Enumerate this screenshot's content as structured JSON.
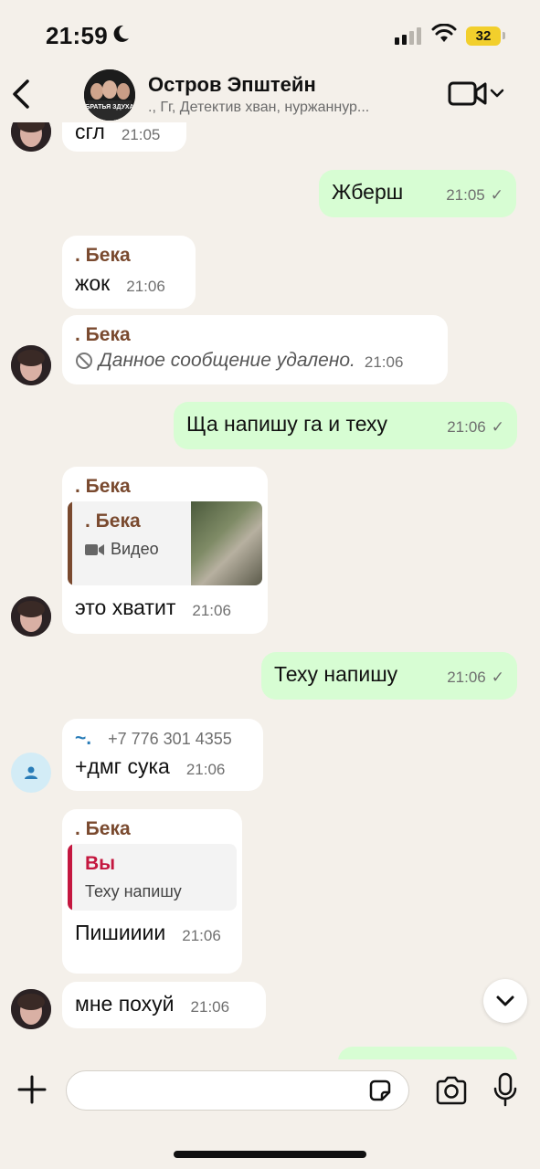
{
  "status_bar": {
    "time": "21:59",
    "battery": "32",
    "battery_color": "#f2cf2c"
  },
  "header": {
    "title": "Остров Эпштейн",
    "members": "., Гг, Детектив хван, нуржаннур...",
    "avatar_caption": "БРАТЬЯ ЗДУХА"
  },
  "colors": {
    "incoming_bubble": "#ffffff",
    "outgoing_bubble": "#d7fdd3",
    "background": "#f4f0ea",
    "sender_name": "#7a4a2f",
    "self_quote": "#c4173f",
    "contact_tilde": "#2a7db8"
  },
  "messages": [
    {
      "direction": "in",
      "text": "сгл",
      "time": "21:05"
    },
    {
      "direction": "out",
      "text": "Жберш",
      "time": "21:05",
      "status": "✓"
    },
    {
      "direction": "in",
      "sender": ". Бека",
      "text": "жок",
      "time": "21:06"
    },
    {
      "direction": "in",
      "sender": ". Бека",
      "deleted": true,
      "text": "Данное сообщение удалено.",
      "time": "21:06"
    },
    {
      "direction": "out",
      "text": "Ща напишу га и теху",
      "time": "21:06",
      "status": "✓"
    },
    {
      "direction": "in",
      "sender": ". Бека",
      "quote": {
        "name": ". Бека",
        "subtitle": "Видео",
        "icon": "video-icon"
      },
      "text": "это хватит",
      "time": "21:06"
    },
    {
      "direction": "out",
      "text": "Теху напишу",
      "time": "21:06",
      "status": "✓"
    },
    {
      "direction": "in",
      "sender": "~.",
      "phone": "+7 776 301 4355",
      "text": "+дмг сука",
      "time": "21:06"
    },
    {
      "direction": "in",
      "sender": ". Бека",
      "quote": {
        "name": "Вы",
        "subtitle": "Теху напишу"
      },
      "text": "Пишииии",
      "time": "21:06"
    },
    {
      "direction": "in",
      "text": "мне похуй",
      "time": "21:06"
    }
  ],
  "composer": {
    "placeholder": "",
    "icons": [
      "plus-icon",
      "sticker-icon",
      "camera-icon",
      "microphone-icon"
    ]
  }
}
